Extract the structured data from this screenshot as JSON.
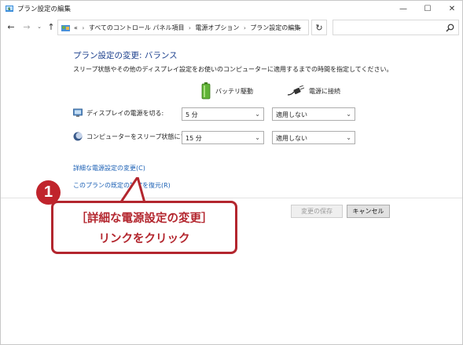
{
  "window": {
    "title": "プラン設定の編集",
    "controls": {
      "minimize": "—",
      "maximize": "☐",
      "close": "✕"
    }
  },
  "nav": {
    "back": "←",
    "forward": "→",
    "dropdown": "⌄",
    "up": "↑",
    "breadcrumbs": [
      "すべてのコントロール パネル項目",
      "電源オプション",
      "プラン設定の編集"
    ],
    "breadcrumb_lead": "«",
    "breadcrumb_sep": "›",
    "address_dropdown": "⌄",
    "refresh": "↻",
    "search_placeholder": ""
  },
  "main": {
    "heading": "プラン設定の変更: バランス",
    "description": "スリープ状態やその他のディスプレイ設定をお使いのコンピューターに適用するまでの時間を指定してください。",
    "columns": {
      "battery": "バッテリ駆動",
      "plugged": "電源に接続"
    },
    "rows": {
      "display": {
        "label": "ディスプレイの電源を切る:",
        "battery_value": "5 分",
        "plugged_value": "適用しない"
      },
      "sleep": {
        "label": "コンピューターをスリープ状態にする:",
        "battery_value": "15 分",
        "plugged_value": "適用しない"
      }
    },
    "links": {
      "advanced": "詳細な電源設定の変更(C)",
      "restore": "このプランの既定の設定を復元(R)"
    },
    "buttons": {
      "save": "変更の保存",
      "cancel": "キャンセル"
    }
  },
  "annotation": {
    "badge": "1",
    "line1": "［詳細な電源設定の変更］",
    "line2": "リンクをクリック",
    "color": "#b3262e"
  }
}
